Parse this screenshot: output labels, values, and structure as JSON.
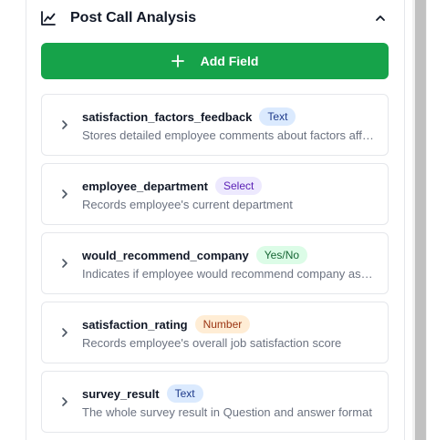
{
  "section": {
    "title": "Post Call Analysis",
    "icon": "line-chart-icon",
    "collapse_icon": "chevron-up-icon"
  },
  "add_field": {
    "label": "Add Field",
    "icon": "plus-icon",
    "color": "#16a34a"
  },
  "fields": [
    {
      "name": "satisfaction_factors_feedback",
      "type": "Text",
      "type_key": "text",
      "description": "Stores detailed employee comments about factors affecting satisfaction"
    },
    {
      "name": "employee_department",
      "type": "Select",
      "type_key": "select",
      "description": "Records employee's current department"
    },
    {
      "name": "would_recommend_company",
      "type": "Yes/No",
      "type_key": "yesno",
      "description": "Indicates if employee would recommend company as a workplace"
    },
    {
      "name": "satisfaction_rating",
      "type": "Number",
      "type_key": "number",
      "description": "Records employee's overall job satisfaction score"
    },
    {
      "name": "survey_result",
      "type": "Text",
      "type_key": "text",
      "description": "The whole survey result in Question and answer format"
    }
  ]
}
